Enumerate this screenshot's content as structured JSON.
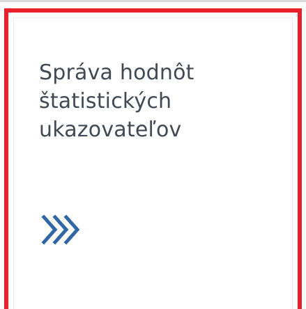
{
  "tile": {
    "title_lines": [
      "Správa hodnôt",
      "štatistických",
      "ukazovateľov"
    ],
    "icon": "triple-chevron-right-icon",
    "colors": {
      "highlight_border": "#e8202a",
      "title_text": "#3f4a55",
      "icon": "#2f66a6"
    }
  }
}
